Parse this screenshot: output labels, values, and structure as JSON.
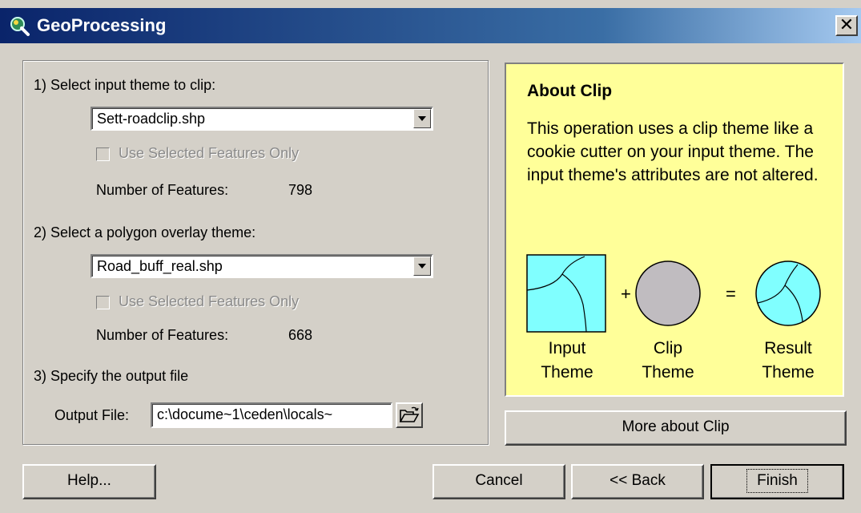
{
  "window": {
    "title": "GeoProcessing"
  },
  "input_theme": {
    "label": "1) Select input theme to clip:",
    "selected": "Sett-roadclip.shp",
    "use_selected_label": "Use Selected Features Only",
    "use_selected_checked": false,
    "features_label": "Number of Features:",
    "features_count": "798"
  },
  "overlay_theme": {
    "label": "2) Select a polygon overlay theme:",
    "selected": "Road_buff_real.shp",
    "use_selected_label": "Use Selected Features Only",
    "use_selected_checked": false,
    "features_label": "Number of Features:",
    "features_count": "668"
  },
  "output": {
    "label": "3) Specify the output file",
    "field_label": "Output File:",
    "value": "c:\\docume~1\\ceden\\locals~"
  },
  "about": {
    "title": "About Clip",
    "description": "This operation uses a clip theme like a cookie cutter on your input theme.  The input theme's attributes are not altered.",
    "diagram": {
      "plus": "+",
      "equals": "=",
      "input_caption": [
        "Input",
        "Theme"
      ],
      "clip_caption": [
        "Clip",
        "Theme"
      ],
      "result_caption": [
        "Result",
        "Theme"
      ],
      "input_fill": "#80ffff",
      "clip_fill": "#c0bcc0",
      "result_fill": "#80ffff"
    },
    "more_button": "More about Clip"
  },
  "buttons": {
    "help": "Help...",
    "cancel": "Cancel",
    "back": "<< Back",
    "finish": "Finish"
  },
  "colors": {
    "dialog_bg": "#d4d0c8",
    "title_bar": "#0a246a",
    "about_bg": "#ffff99"
  }
}
